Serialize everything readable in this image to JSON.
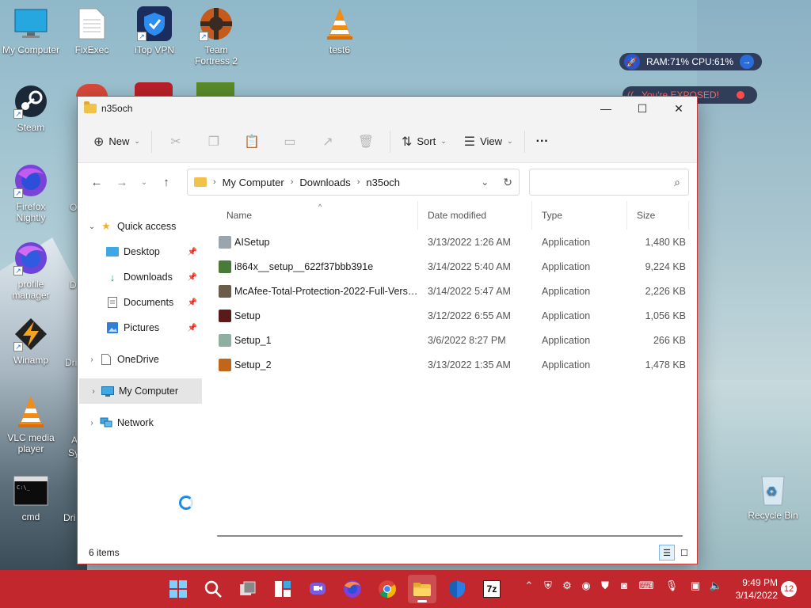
{
  "desktop": {
    "icons": [
      {
        "label": "My Computer",
        "name": "desktop-icon-my-computer"
      },
      {
        "label": "FixExec",
        "name": "desktop-icon-fixexec"
      },
      {
        "label": "iTop VPN",
        "name": "desktop-icon-itop-vpn"
      },
      {
        "label": "Team Fortress 2",
        "name": "desktop-icon-team-fortress"
      },
      {
        "label": "test6",
        "name": "desktop-icon-test6"
      },
      {
        "label": "Steam",
        "name": "desktop-icon-steam"
      },
      {
        "label": "Firefox Nightly",
        "name": "desktop-icon-firefox-nightly"
      },
      {
        "label": "profile manager",
        "name": "desktop-icon-profile-manager"
      },
      {
        "label": "Winamp",
        "name": "desktop-icon-winamp"
      },
      {
        "label": "VLC media player",
        "name": "desktop-icon-vlc"
      },
      {
        "label": "cmd",
        "name": "desktop-icon-cmd"
      },
      {
        "label": "Recycle Bin",
        "name": "desktop-icon-recycle-bin"
      }
    ],
    "partial_labels": [
      "O",
      "D",
      "Dri",
      "A",
      "Sy",
      "Dri"
    ],
    "widget_stats": "RAM:71%  CPU:61%",
    "widget_exposed": "You're EXPOSED!"
  },
  "window": {
    "title": "n35och",
    "controls": {
      "minimize": "—",
      "maximize": "☐",
      "close": "✕"
    }
  },
  "toolbar": {
    "new_label": "New",
    "sort_label": "Sort",
    "view_label": "View",
    "more_label": "···"
  },
  "address": {
    "crumbs": [
      "My Computer",
      "Downloads",
      "n35och"
    ]
  },
  "search": {
    "placeholder": ""
  },
  "navpane": {
    "quick_access": "Quick access",
    "desktop": "Desktop",
    "downloads": "Downloads",
    "documents": "Documents",
    "pictures": "Pictures",
    "onedrive": "OneDrive",
    "my_computer": "My Computer",
    "network": "Network"
  },
  "columns": {
    "name": "Name",
    "date": "Date modified",
    "type": "Type",
    "size": "Size"
  },
  "files": [
    {
      "name": "AISetup",
      "date": "3/13/2022 1:26 AM",
      "type": "Application",
      "size": "1,480 KB",
      "color": "#9aa5ad"
    },
    {
      "name": "i864x__setup__622f37bbb391e",
      "date": "3/14/2022 5:40 AM",
      "type": "Application",
      "size": "9,224 KB",
      "color": "#4a7a3a"
    },
    {
      "name": "McAfee-Total-Protection-2022-Full-Versi...",
      "date": "3/14/2022 5:47 AM",
      "type": "Application",
      "size": "2,226 KB",
      "color": "#6b5b4b"
    },
    {
      "name": "Setup",
      "date": "3/12/2022 6:55 AM",
      "type": "Application",
      "size": "1,056 KB",
      "color": "#5a1a1a"
    },
    {
      "name": "Setup_1",
      "date": "3/6/2022 8:27 PM",
      "type": "Application",
      "size": "266 KB",
      "color": "#8fb0a0"
    },
    {
      "name": "Setup_2",
      "date": "3/13/2022 1:35 AM",
      "type": "Application",
      "size": "1,478 KB",
      "color": "#c0661a"
    }
  ],
  "status": {
    "items": "6 items"
  },
  "taskbar": {
    "time": "9:49 PM",
    "date": "3/14/2022",
    "notifications": "12",
    "sevenzip_label": "7z"
  },
  "colors": {
    "taskbar": "#c1272d",
    "window_border": "#c83a3a",
    "accent": "#1f8be0"
  }
}
